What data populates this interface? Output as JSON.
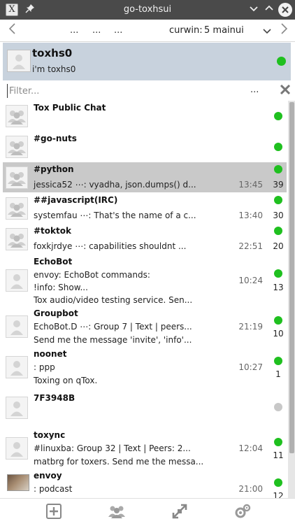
{
  "window": {
    "title": "go-toxhsui",
    "app_icon": "x-app-icon",
    "pin_icon": "pin-icon",
    "minimize_icon": "chevron-down-icon",
    "maximize_icon": "chevron-up-icon",
    "close_icon": "close-icon"
  },
  "nav": {
    "dots": [
      "...",
      "...",
      "..."
    ],
    "label": "curwin:",
    "select_value": "5 mainui"
  },
  "self": {
    "name": "toxhs0",
    "status_message": "i'm toxhs0",
    "status_color": "#1fc01f"
  },
  "filter": {
    "placeholder": "Filter...",
    "value": "",
    "menu": "..."
  },
  "contacts": [
    {
      "name": "Tox Public Chat",
      "type": "group",
      "status": "online",
      "lines": [],
      "time": "",
      "count": ""
    },
    {
      "name": "#go-nuts",
      "type": "group",
      "status": "online",
      "lines": [],
      "time": "",
      "count": ""
    },
    {
      "name": "#python",
      "type": "group",
      "status": "online",
      "lines": [
        "jessica52 ⋯: vyadha, json.dumps() d..."
      ],
      "time": "13:45",
      "count": "39",
      "selected": true
    },
    {
      "name": "##javascript(IRC)",
      "type": "group",
      "status": "online",
      "lines": [
        "systemfau ⋯: That's the name of a c..."
      ],
      "time": "13:40",
      "count": "30"
    },
    {
      "name": "#toktok",
      "type": "group",
      "status": "online",
      "lines": [
        "foxkjrdye ⋯: capabilities shouldnt ..."
      ],
      "time": "22:51",
      "count": "20"
    },
    {
      "name": "EchoBot",
      "type": "friend",
      "status": "online",
      "lines": [
        "envoy: EchoBot commands:",
        "!info: Show...",
        "Tox audio/video testing service. Sen..."
      ],
      "time": "10:24",
      "count": "13"
    },
    {
      "name": "Groupbot",
      "type": "friend",
      "status": "online",
      "lines": [
        "EchoBot.D ⋯: Group 7 | Text | peers...",
        "Send me the message 'invite', 'info'..."
      ],
      "time": "21:19",
      "count": "10"
    },
    {
      "name": "noonet",
      "type": "friend",
      "status": "online",
      "lines": [
        ": ppp",
        "Toxing on qTox."
      ],
      "time": "10:27",
      "count": "1"
    },
    {
      "name": "7F3948B",
      "type": "friend",
      "status": "offline",
      "lines": [],
      "time": "",
      "count": ""
    },
    {
      "name": "toxync",
      "type": "friend",
      "status": "online",
      "lines": [
        "#linuxba: Group 32 | Text | Peers: 2...",
        "matbrg for toxers. Send me the messa..."
      ],
      "time": "12:04",
      "count": "11"
    },
    {
      "name": "envoy",
      "type": "photo",
      "status": "online",
      "lines": [
        ": podcast"
      ],
      "time": "21:00",
      "count": "12"
    }
  ],
  "toolbar": {
    "add_icon": "add-friend-icon",
    "groups_icon": "groups-icon",
    "transfers_icon": "file-transfers-icon",
    "settings_icon": "gear-icon"
  },
  "colors": {
    "titlebar": "#4a4a4a",
    "self_background": "#c8d2dd",
    "selected_row": "#c9c9c9",
    "online": "#1fc01f",
    "offline": "#c8c8c8"
  }
}
